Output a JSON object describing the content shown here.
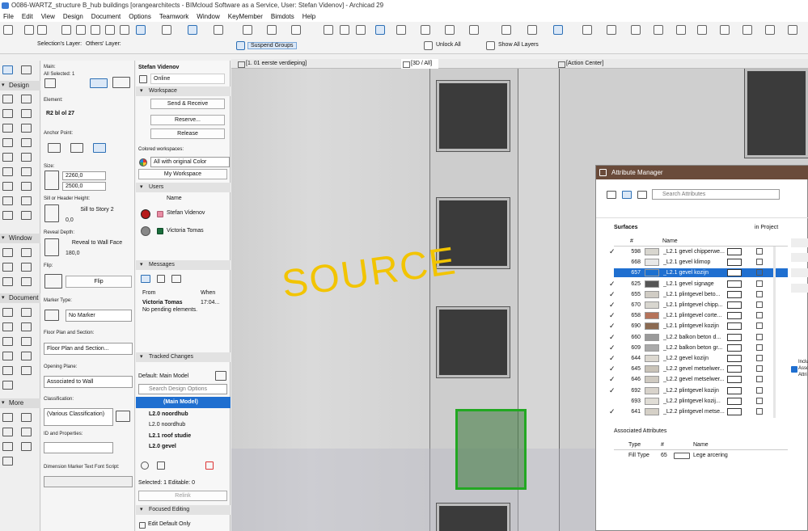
{
  "title_bar": {
    "text": "O086-WARTZ_structure B_hub buildings [orangearchitects - BIMcloud Software as a Service, User: Stefan Videnov] - Archicad 29"
  },
  "menu": [
    "File",
    "Edit",
    "View",
    "Design",
    "Document",
    "Options",
    "Teamwork",
    "Window",
    "KeyMember",
    "Bimdots",
    "Help"
  ],
  "toolbar": {
    "selection_layer_label": "Selection's Layer:",
    "others_layer_label": "Others' Layer:",
    "suspend_groups": "Suspend Groups",
    "unlock_all": "Unlock All",
    "show_all_layers": "Show All Layers"
  },
  "toolbox": {
    "sections": [
      "Design",
      "Window",
      "Document",
      "More"
    ]
  },
  "info_box": {
    "main_label": "Main:",
    "all_selected": "All Selected: 1",
    "element_label": "Element:",
    "element_value": "R2 bl ol 27",
    "anchor_label": "Anchor Point:",
    "size_label": "Size:",
    "width_value": "2260,0",
    "height_value": "2500,0",
    "sill_label": "Sill or Header Height:",
    "sill_ref": "Sill to Story 2",
    "sill_value": "0,0",
    "reveal_label": "Reveal Depth:",
    "reveal_ref": "Reveal to Wall Face",
    "reveal_value": "180,0",
    "flip_label": "Flip:",
    "flip_button": "Flip",
    "marker_label": "Marker Type:",
    "marker_value": "No Marker",
    "floor_plan_label": "Floor Plan and Section:",
    "floor_plan_value": "Floor Plan and Section...",
    "opening_label": "Opening Plane:",
    "opening_value": "Associated to Wall",
    "classification_label": "Classification:",
    "classification_value": "(Various Classification)",
    "id_label": "ID and Properties:",
    "dimension_label": "Dimension Marker Text Font Script:"
  },
  "navigator": {
    "user": "Stefan Videnov",
    "status": "Online",
    "workspace_header": "Workspace",
    "send_receive": "Send & Receive",
    "reserve": "Reserve...",
    "release": "Release",
    "colored_label": "Colored workspaces:",
    "colored_value": "All with original Color",
    "my_workspace": "My Workspace",
    "users_header": "Users",
    "users_name_col": "Name",
    "users": [
      "Stefan Videnov",
      "Victoria Tomas"
    ],
    "messages_header": "Messages",
    "msg_from_col": "From",
    "msg_when_col": "When",
    "msg_from": "Victoria Tomas",
    "msg_when": "17:04...",
    "msg_text": "No pending elements.",
    "tracked_changes": "Tracked Changes",
    "default_model": "Default: Main Model",
    "search_placeholder": "Search Design Options",
    "main_model": "(Main Model)",
    "options": [
      "L2.0 noordhub",
      "L2.0 noordhub",
      "L2.1 roof studie",
      "L2.0 gevel"
    ],
    "selected_info": "Selected: 1 Editable: 0",
    "relink": "Relink",
    "focused_editing": "Focused Editing",
    "edit_default_only": "Edit Default Only"
  },
  "view_tabs": [
    "[1. 01 eerste verdieping]",
    "[3D / All]",
    "[Action Center]"
  ],
  "annotation": "SOURCE",
  "attribute_manager": {
    "title": "Attribute Manager",
    "search_placeholder": "Search Attributes",
    "surfaces_label": "Surfaces",
    "in_project": "in Project",
    "columns": {
      "num": "#",
      "name": "Name"
    },
    "rows": [
      {
        "id": "598",
        "name": "_L2.1 gevel chipperwe...",
        "sw": "#d8d6cf",
        "checked": true
      },
      {
        "id": "668",
        "name": "_L2.1 gevel klimop",
        "sw": "#e8e8e8",
        "checked": false
      },
      {
        "id": "657",
        "name": "_L2.1 gevel kozijn",
        "sw": "#1a6fd0",
        "checked": true,
        "selected": true
      },
      {
        "id": "625",
        "name": "_L2.1 gevel signage",
        "sw": "#555555",
        "checked": true
      },
      {
        "id": "655",
        "name": "_L2.1 plintgevel beto...",
        "sw": "#d0ccc4",
        "checked": true
      },
      {
        "id": "670",
        "name": "_L2.1 plintgevel chipp...",
        "sw": "#d8d6cf",
        "checked": true
      },
      {
        "id": "658",
        "name": "_L2.1 plintgevel corte...",
        "sw": "#b5735a",
        "checked": true
      },
      {
        "id": "690",
        "name": "_L2.1 plintgevel kozijn",
        "sw": "#8b6a52",
        "checked": true
      },
      {
        "id": "660",
        "name": "_L2.2 balkon beton d...",
        "sw": "#9a9a9a",
        "checked": true
      },
      {
        "id": "609",
        "name": "_L2.2 balkon beton gr...",
        "sw": "#aaaaaa",
        "checked": true
      },
      {
        "id": "644",
        "name": "_L2.2 gevel kozijn",
        "sw": "#dcd8d0",
        "checked": true
      },
      {
        "id": "645",
        "name": "_L2.2 gevel metselwer...",
        "sw": "#c9c3b8",
        "checked": true
      },
      {
        "id": "646",
        "name": "_L2.2 gevel metselwer...",
        "sw": "#cfcac1",
        "checked": true
      },
      {
        "id": "692",
        "name": "_L2.2 plintgevel kozijn",
        "sw": "#d8d3cb",
        "checked": true
      },
      {
        "id": "693",
        "name": "_L2.2 plintgevel kozij...",
        "sw": "#e0ddd6",
        "checked": false
      },
      {
        "id": "641",
        "name": "_L2.2 plintgevel metse...",
        "sw": "#d5d0c7",
        "checked": true
      }
    ],
    "associated_label": "Associated Attributes",
    "assoc_columns": {
      "type": "Type",
      "num": "#",
      "name": "Name"
    },
    "assoc_row": {
      "type": "Fill Type",
      "num": "65",
      "name": "Lege arcering"
    },
    "side_text": "Inclu Asso Attri"
  },
  "colors": {
    "accent": "#1f6fd0",
    "title_brown": "#6a4b3a",
    "selection_green": "#22a822",
    "annotation_yellow": "#f2c400"
  }
}
